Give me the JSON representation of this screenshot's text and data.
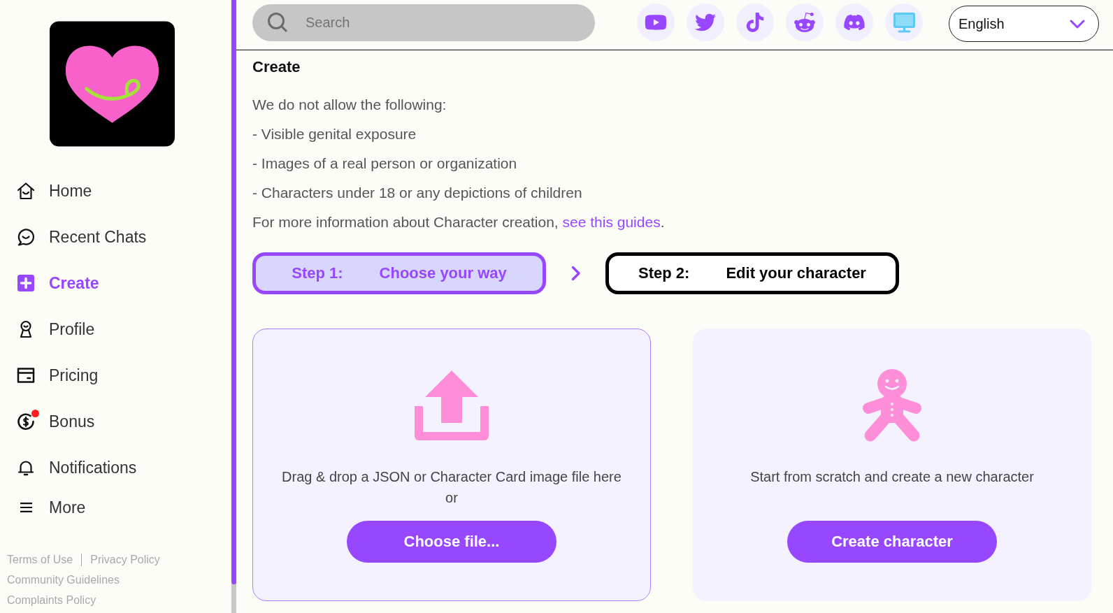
{
  "sidebar": {
    "nav": [
      {
        "label": "Home",
        "selected": false,
        "dot": false
      },
      {
        "label": "Recent Chats",
        "selected": false,
        "dot": false
      },
      {
        "label": "Create",
        "selected": true,
        "dot": false
      },
      {
        "label": "Profile",
        "selected": false,
        "dot": false
      },
      {
        "label": "Pricing",
        "selected": false,
        "dot": false
      },
      {
        "label": "Bonus",
        "selected": false,
        "dot": true
      },
      {
        "label": "Notifications",
        "selected": false,
        "dot": false
      },
      {
        "label": "More",
        "selected": false,
        "dot": false
      }
    ],
    "footer_links": [
      [
        "Terms of Use",
        "Privacy Policy"
      ],
      [
        "Community Guidelines"
      ],
      [
        "Complaints Policy"
      ]
    ]
  },
  "topbar": {
    "search": {
      "placeholder": "Search"
    },
    "language": {
      "value": "English"
    }
  },
  "page": {
    "title": "Create",
    "intro": "We do not allow the following:",
    "rules": [
      "- Visible genital exposure",
      "- Images of a real person or organization",
      "- Characters under 18 or any depictions of children"
    ],
    "info": {
      "text": "For more information about Character creation, ",
      "link": "see this guides",
      "end": "."
    },
    "steps": [
      {
        "label": "Step 1:",
        "title": "Choose your way",
        "selected": true
      },
      {
        "label": "Step 2:",
        "title": "Edit your character",
        "selected": false
      }
    ],
    "cards": [
      {
        "kind": "upload",
        "text": "Drag & drop a JSON or Character Card image file here",
        "subtext": "or",
        "button": "Choose file..."
      },
      {
        "kind": "scratch",
        "text": "Start from scratch and create a new character",
        "button": "Create character"
      }
    ]
  }
}
